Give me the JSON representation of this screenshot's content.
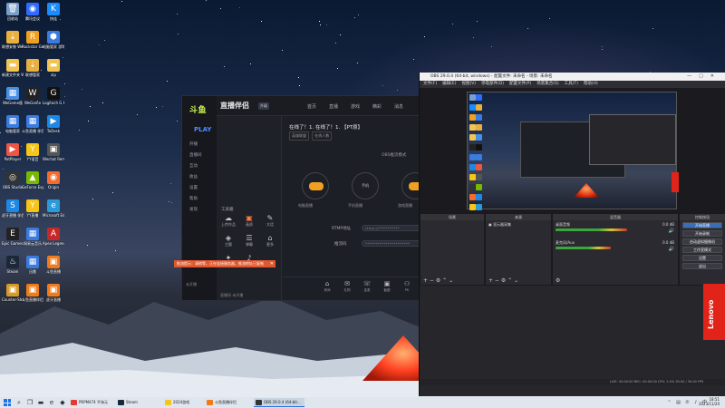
{
  "desktop": {
    "icons": [
      {
        "label": "回收站",
        "icon": "recycle-bin-icon",
        "color": "#7aa0c8",
        "glyph": "🗑"
      },
      {
        "label": "腾讯会议",
        "icon": "tencent-meeting-icon",
        "color": "#2f6bff",
        "glyph": "◉"
      },
      {
        "label": "快连",
        "icon": "quick-connect-icon",
        "color": "#1a8cff",
        "glyph": "K"
      },
      {
        "label": "联想安装 WeGame版",
        "icon": "install-icon",
        "color": "#e8b040",
        "glyph": "⇣"
      },
      {
        "label": "Rockstar Games",
        "icon": "rockstar-icon",
        "color": "#f0a020",
        "glyph": "R"
      },
      {
        "label": "电脑管家 游戏",
        "icon": "pc-manager-icon",
        "color": "#3a7be0",
        "glyph": "⬢"
      },
      {
        "label": "新建文件夹 WeGame版",
        "icon": "folder-icon",
        "color": "#f1c454",
        "glyph": "▬"
      },
      {
        "label": "联想管家",
        "icon": "lenovo-manager-icon",
        "color": "#e8b040",
        "glyph": "⇣"
      },
      {
        "label": "zip",
        "icon": "zip-icon",
        "color": "#f1c454",
        "glyph": "▬"
      },
      {
        "label": "WeGame版",
        "icon": "wegame-icon",
        "color": "#4a90e2",
        "glyph": "▦"
      },
      {
        "label": "WeGame",
        "icon": "wegame-app-icon",
        "color": "#222",
        "glyph": "W"
      },
      {
        "label": "Logitech G HUB",
        "icon": "logitech-icon",
        "color": "#111",
        "glyph": "G"
      },
      {
        "label": "电脑管家",
        "icon": "pc-manager-shortcut-icon",
        "color": "#3a7be0",
        "glyph": "▦"
      },
      {
        "label": "斗鱼直播 伴侣",
        "icon": "douyu-icon",
        "color": "#3a7be0",
        "glyph": "▦"
      },
      {
        "label": "ToDesk",
        "icon": "todesk-icon",
        "color": "#1e88e5",
        "glyph": "▶"
      },
      {
        "label": "PotPlayer",
        "icon": "potplayer-icon",
        "color": "#e54",
        "glyph": "▶"
      },
      {
        "label": "YY语音",
        "icon": "yy-icon",
        "color": "#f5c518",
        "glyph": "Y"
      },
      {
        "label": "Wechat Remote",
        "icon": "wechat-icon",
        "color": "#555",
        "glyph": "▣"
      },
      {
        "label": "OBS Studio",
        "icon": "obs-icon",
        "color": "#333",
        "glyph": "◎"
      },
      {
        "label": "GeForce Experience",
        "icon": "geforce-icon",
        "color": "#76b900",
        "glyph": "▲"
      },
      {
        "label": "Origin",
        "icon": "origin-icon",
        "color": "#f56c2d",
        "glyph": "◉"
      },
      {
        "label": "虎牙直播 伴侣",
        "icon": "huya-icon",
        "color": "#1e88e5",
        "glyph": "S"
      },
      {
        "label": "YY直播",
        "icon": "yy-live-icon",
        "color": "#f5c518",
        "glyph": "Y"
      },
      {
        "label": "Microsoft Edge",
        "icon": "edge-icon",
        "color": "#2b9ad8",
        "glyph": "e"
      },
      {
        "label": "Epic Games Launcher",
        "icon": "epic-icon",
        "color": "#222",
        "glyph": "E"
      },
      {
        "label": "网易云音乐",
        "icon": "netease-icon",
        "color": "#3a7be0",
        "glyph": "▦"
      },
      {
        "label": "Apex Legends",
        "icon": "apex-icon",
        "color": "#c62828",
        "glyph": "A"
      },
      {
        "label": "Steam",
        "icon": "steam-icon",
        "color": "#1b2838",
        "glyph": "♨"
      },
      {
        "label": "迅雷",
        "icon": "thunder-icon",
        "color": "#3a7be0",
        "glyph": "▦"
      },
      {
        "label": "斗鱼直播",
        "icon": "douyu-live-icon",
        "color": "#f07b1a",
        "glyph": "▣"
      },
      {
        "label": "Counter-Strike Global Off",
        "icon": "csgo-icon",
        "color": "#d49a2a",
        "glyph": "▣"
      },
      {
        "label": "斗鱼直播伴侣",
        "icon": "douyu-companion-icon",
        "color": "#f07b1a",
        "glyph": "▣"
      },
      {
        "label": "虎牙直播",
        "icon": "huya-live-icon",
        "color": "#f07b1a",
        "glyph": "▣"
      }
    ]
  },
  "stream_app": {
    "logo": "斗鱼",
    "play_label": "PLAY",
    "brand": "直播伴侣",
    "version_tag": "升级",
    "tabs": [
      "首页",
      "直播",
      "游戏",
      "精彩",
      "消息"
    ],
    "side_items": [
      "开播",
      "直播间",
      "互动",
      "收益",
      "设置",
      "帮助",
      "发现"
    ],
    "stream_title": "在线了！1. 在线了！1. 【PT原】",
    "tags": [
      "英雄联盟",
      "在线人数"
    ],
    "tool_section_title": "工具箱",
    "tools": [
      {
        "label": "上传作品",
        "icon": "upload-icon",
        "glyph": "☁",
        "active": false
      },
      {
        "label": "画质",
        "icon": "image-icon",
        "glyph": "▣",
        "active": true
      },
      {
        "label": "大话",
        "icon": "chat-icon",
        "glyph": "✎",
        "active": false
      },
      {
        "label": "主题",
        "icon": "theme-icon",
        "glyph": "◈",
        "active": false
      },
      {
        "label": "弹幕",
        "icon": "danmu-icon",
        "glyph": "☰",
        "active": false
      },
      {
        "label": "更多",
        "icon": "more-icon",
        "glyph": "⌂",
        "active": false
      },
      {
        "label": "特效",
        "icon": "effect-icon",
        "glyph": "✦",
        "active": false
      },
      {
        "label": "音效",
        "icon": "sound-icon",
        "glyph": "♪",
        "active": false
      }
    ],
    "mode_label": "OBS推流模式",
    "options": [
      {
        "label": "推流",
        "sublabel": "电脑直播"
      },
      {
        "label": "手机",
        "sublabel": "手机直播"
      },
      {
        "label": "游戏",
        "sublabel": "游戏直播"
      }
    ],
    "rtmp_label": "RTMP地址",
    "rtmp_value": "rtmp://**********",
    "key_label": "推流码",
    "key_value": "**********************",
    "bottom_items": [
      {
        "label": "房间",
        "glyph": "⌂"
      },
      {
        "label": "礼物",
        "glyph": "✉"
      },
      {
        "label": "连麦",
        "glyph": "☏"
      },
      {
        "label": "截图",
        "glyph": "▣"
      },
      {
        "label": "PK",
        "glyph": "⚇"
      }
    ],
    "warning": "推流提示：请稍等，正在连接服务器，推流地址已复制",
    "footer_status": "直播间 未开播",
    "left_status": "未开播"
  },
  "obs": {
    "title": "OBS 29.0.4 (64-bit, windows) - 配置文件: 未命名 - 场景: 未命名",
    "menus": [
      "文件(F)",
      "编辑(E)",
      "视图(V)",
      "停靠部件(D)",
      "配置文件(P)",
      "场景集合(S)",
      "工具(T)",
      "帮助(H)"
    ],
    "docks": {
      "scenes": "场景",
      "sources": "来源",
      "mixer": "混音器",
      "transitions": "转场特效",
      "controls": "控制按钮"
    },
    "source_item": "显示器采集",
    "mixer_channels": [
      {
        "name": "桌面音频",
        "db": "0.0 dB",
        "level": 0.72
      },
      {
        "name": "麦克风/Aux",
        "db": "0.0 dB",
        "level": 0.55
      }
    ],
    "control_buttons": [
      "开始直播",
      "开始录制",
      "启动虚拟摄像机",
      "工作室模式",
      "设置",
      "退出"
    ],
    "status": "LIVE: 00:00:00   REC: 00:00:00   CPU: 2.0%   30.00 / 30.00 FPS",
    "lenovo_brand": "Lenovo"
  },
  "taskbar": {
    "apps": [
      {
        "label": "PRPM474 平淘元",
        "color": "#e53935",
        "active": false
      },
      {
        "label": "Steam",
        "color": "#1b2838",
        "active": false
      },
      {
        "label": "2024游戏",
        "color": "#f5c518",
        "active": false
      },
      {
        "label": "斗鱼直播伴侣",
        "color": "#f07b1a",
        "active": false
      },
      {
        "label": "OBS 29.0.4 (64-bit...",
        "color": "#333",
        "active": true
      }
    ],
    "time": "18:51",
    "date": "2023/11/20"
  }
}
